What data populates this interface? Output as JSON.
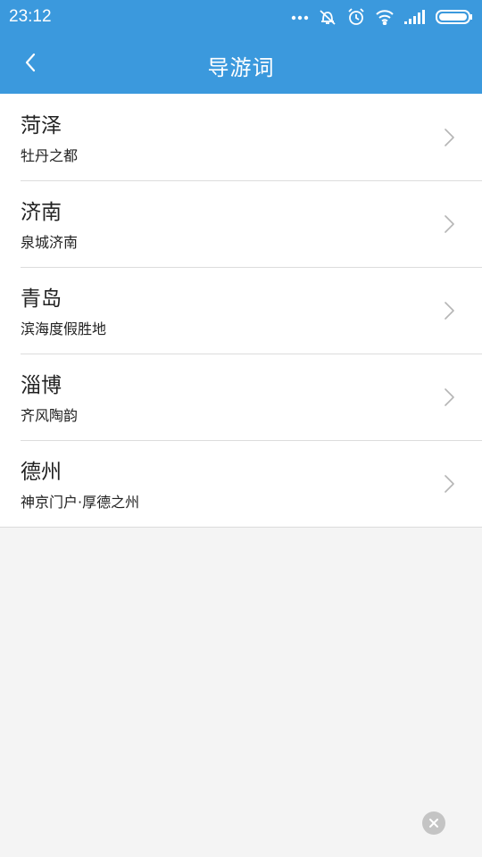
{
  "status_bar": {
    "time": "23:12",
    "icons": [
      "more-dots-icon",
      "vibrate-icon",
      "alarm-icon",
      "wifi-icon",
      "signal-icon",
      "battery-icon"
    ]
  },
  "header": {
    "title": "导游词",
    "back_icon": "chevron-left-icon",
    "background": "#3b99dd"
  },
  "list": {
    "items": [
      {
        "title": "菏泽",
        "subtitle": "牡丹之都"
      },
      {
        "title": "济南",
        "subtitle": "泉城济南"
      },
      {
        "title": "青岛",
        "subtitle": "滨海度假胜地"
      },
      {
        "title": "淄博",
        "subtitle": "齐风陶韵"
      },
      {
        "title": "德州",
        "subtitle": "神京门户·厚德之州"
      }
    ]
  },
  "floating": {
    "close_icon": "close-icon"
  }
}
